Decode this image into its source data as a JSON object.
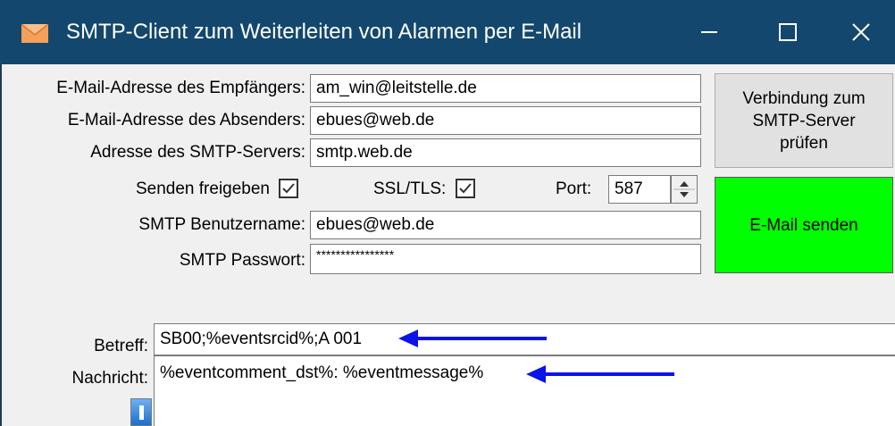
{
  "window": {
    "title": "SMTP-Client zum Weiterleiten von Alarmen per E-Mail",
    "icon": "envelope-icon",
    "controls": {
      "minimize": "minimize-icon",
      "maximize": "maximize-icon",
      "close": "close-icon"
    }
  },
  "form": {
    "recipient": {
      "label": "E-Mail-Adresse des Empfängers:",
      "value": "am_win@leitstelle.de"
    },
    "sender": {
      "label": "E-Mail-Adresse des Absenders:",
      "value": "ebues@web.de"
    },
    "smtp_server": {
      "label": "Adresse des SMTP-Servers:",
      "value": "smtp.web.de"
    },
    "send_enabled": {
      "label": "Senden freigeben",
      "checked": true
    },
    "ssl_tls": {
      "label": "SSL/TLS:",
      "checked": true
    },
    "port": {
      "label": "Port:",
      "value": "587"
    },
    "username": {
      "label": "SMTP Benutzername:",
      "value": "ebues@web.de"
    },
    "password": {
      "label": "SMTP Passwort:",
      "value": "****************"
    },
    "subject": {
      "label": "Betreff:",
      "value": "SB00;%eventsrcid%;A 001"
    },
    "message": {
      "label": "Nachricht:",
      "value": "%eventcomment_dst%: %eventmessage%"
    }
  },
  "buttons": {
    "test_connection": {
      "line1": "Verbindung zum",
      "line2": "SMTP-Server",
      "line3": "prüfen"
    },
    "send_email": {
      "label": "E-Mail senden",
      "color": "#00ff00"
    },
    "info_icon": "info-icon"
  },
  "annotations": {
    "arrow_color": "#0a14e6"
  }
}
